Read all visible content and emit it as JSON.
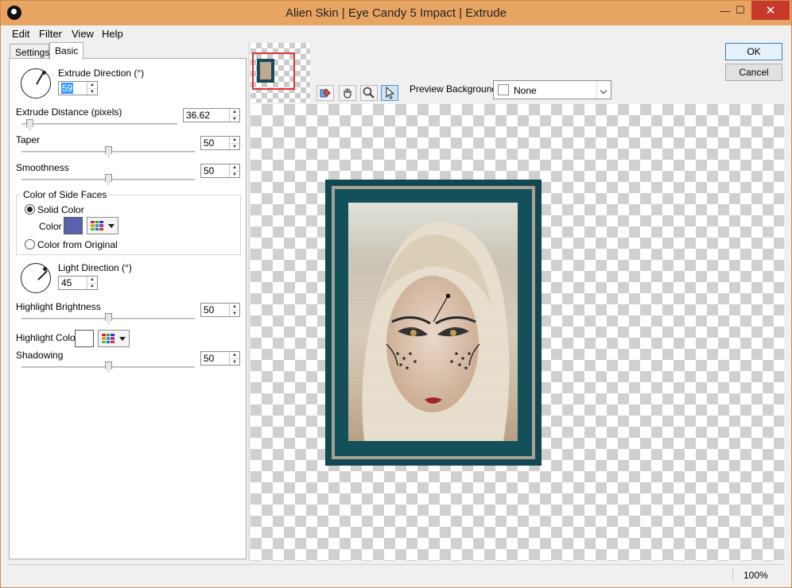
{
  "window": {
    "title": "Alien Skin | Eye Candy 5 Impact | Extrude",
    "minimize": "—",
    "maximize": "☐",
    "close": "✕"
  },
  "menu": [
    "Edit",
    "Filter",
    "View",
    "Help"
  ],
  "tabs": [
    "Settings",
    "Basic"
  ],
  "controls": {
    "extrude_direction": {
      "label": "Extrude Direction (°)",
      "value": "59"
    },
    "extrude_distance": {
      "label": "Extrude Distance (pixels)",
      "value": "36.62",
      "level": 0.05
    },
    "taper": {
      "label": "Taper",
      "value": "50",
      "level": 0.5
    },
    "smoothness": {
      "label": "Smoothness",
      "value": "50",
      "level": 0.5
    },
    "side_faces": {
      "title": "Color of Side Faces",
      "solid_label": "Solid Color",
      "color_label": "Color",
      "original_label": "Color from Original",
      "color": "#5a62b0"
    },
    "light_direction": {
      "label": "Light Direction (°)",
      "value": "45"
    },
    "highlight_brightness": {
      "label": "Highlight Brightness",
      "value": "50",
      "level": 0.5
    },
    "highlight_color": {
      "label": "Highlight Color",
      "color": "#ffffff"
    },
    "shadowing": {
      "label": "Shadowing",
      "value": "50",
      "level": 0.5
    }
  },
  "toolbar": {
    "preview_bg_label": "Preview Background:",
    "preview_bg_value": "None"
  },
  "buttons": {
    "ok": "OK",
    "cancel": "Cancel"
  },
  "status": {
    "zoom": "100%"
  }
}
